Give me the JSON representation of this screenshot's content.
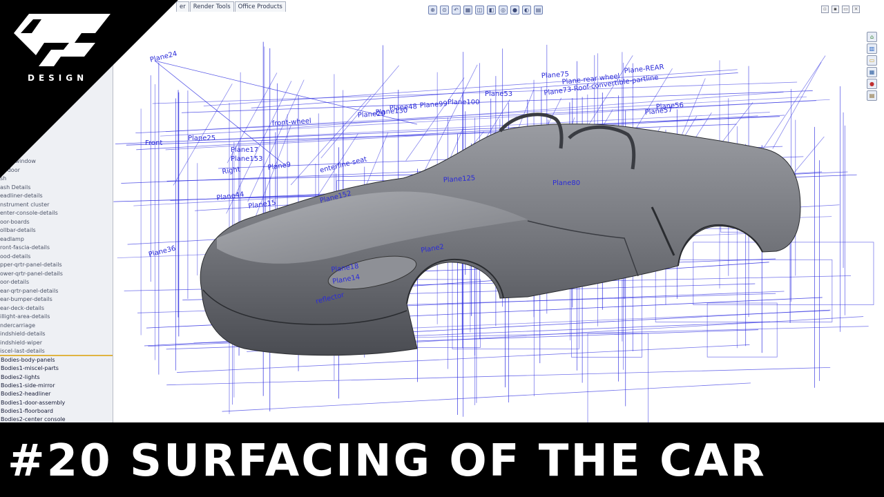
{
  "logo": {
    "text": "DESIGN",
    "icon": "dp-logo-icon"
  },
  "toolbar_tabs": [
    "er",
    "Render Tools",
    "Office Products"
  ],
  "feature_tree": {
    "items": [
      "front window",
      "or door",
      "sh",
      "ash Details",
      "eadliner-details",
      "nstrument cluster",
      "enter-console-details",
      "oor-boards",
      "ollbar-details",
      "eadlamp",
      "ront-fascia-details",
      "ood-details",
      "pper-qrtr-panel-details",
      "ower-qrtr-panel-details",
      "oor-details",
      "ear-qrtr-panel-details",
      "ear-bumper-details",
      "ear-deck-details",
      "illight-area-details",
      "ndercarriage",
      "indshield-details",
      "indshield-wiper",
      "iscel-last-details"
    ],
    "bodies": [
      "Bodies-body-panels",
      "Bodies1-miscel-parts",
      "Bodies2-lights",
      "Bodies1-side-mirror",
      "Bodies2-headliner",
      "Bodies1-door-assembly",
      "Bodies1-floorboard",
      "Bodies2-center console"
    ]
  },
  "planes": [
    "Plane24",
    "Front",
    "Plane25",
    "Plane17",
    "Plane153",
    "Right",
    "Plane9",
    "Plane44",
    "Plane15",
    "Plane36",
    "Plane2",
    "Plane18",
    "Plane14",
    "Plane75",
    "Plane53",
    "Plane100",
    "Plane99",
    "Plane48",
    "Plane130",
    "Plane20",
    "Plane57",
    "Plane56",
    "Plane80",
    "Plane152",
    "Plane125",
    "Plane73-Roof-convertible-partline",
    "Plane-rear wheel",
    "Plane-REAR",
    "front-wheel",
    "enterline-seat",
    "reflector"
  ],
  "colors": {
    "wire": "#2a2ae0",
    "tree_bg": "#eef0f4",
    "banner": "#000000",
    "car": "#6e7076"
  },
  "banner": {
    "title": "#20 SURFACING OF THE CAR"
  }
}
